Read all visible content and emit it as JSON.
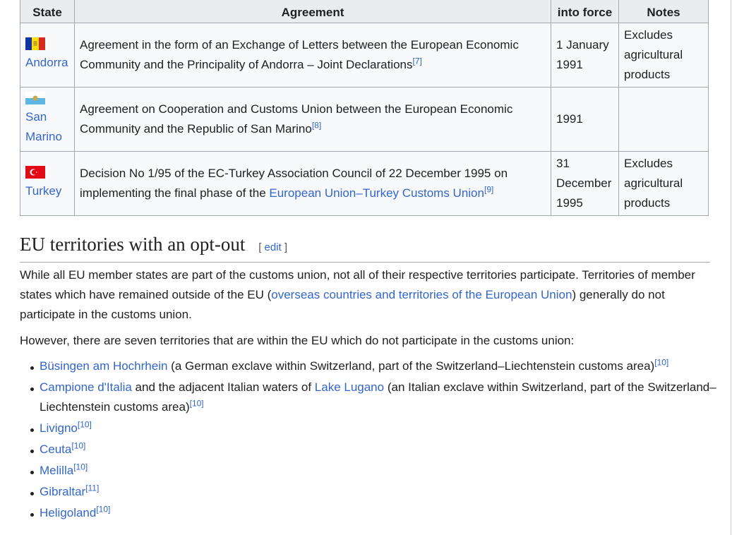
{
  "table": {
    "headers": {
      "state": "State",
      "agreement": "Agreement",
      "entry": "into force",
      "notes": "Notes"
    },
    "rows": [
      {
        "flag": "andorra-flag",
        "state": "Andorra",
        "agreement": "Agreement in the form of an Exchange of Letters between the European Economic Community and the Principality of Andorra – Joint Declarations",
        "agreement_ref": "[7]",
        "date": "1 January 1991",
        "notes": "Excludes agricultural products"
      },
      {
        "flag": "san-marino-flag",
        "state": "San Marino",
        "agreement": "Agreement on Cooperation and Customs Union between the European Economic Community and the Republic of San Marino",
        "agreement_ref": "[8]",
        "date": "1991",
        "notes": ""
      },
      {
        "flag": "turkey-flag",
        "state": "Turkey",
        "agreement_pre": "Decision No 1/95 of the EC-Turkey Association Council of 22 December 1995 on implementing the final phase of the ",
        "agreement_link": "European Union–Turkey Customs Union",
        "agreement_ref": "[9]",
        "date": "31 December 1995",
        "notes": "Excludes agricultural products"
      }
    ]
  },
  "section": {
    "title": "EU territories with an opt-out",
    "edit_open": "[ ",
    "edit_label": "edit",
    "edit_close": " ]"
  },
  "para1": {
    "pre": "While all EU member states are part of the customs union, not all of their respective territories participate. Territories of member states which have remained outside of the EU (",
    "link": "overseas countries and territories of the European Union",
    "post": ") generally do not participate in the customs union."
  },
  "para2": "However, there are seven territories that are within the EU which do not participate in the customs union:",
  "territories": [
    {
      "link": "Büsingen am Hochrhein",
      "text": " (a German exclave within Switzerland, part of the Switzerland–Liechtenstein customs area)",
      "ref": "[10]"
    },
    {
      "link": "Campione d'Italia",
      "text": " and the adjacent Italian waters of ",
      "link2": "Lake Lugano",
      "text2": " (an Italian exclave within Switzerland, part of the Switzerland–Liechtenstein customs area)",
      "ref": "[10]"
    },
    {
      "link": "Livigno",
      "ref": "[10]"
    },
    {
      "link": "Ceuta",
      "ref": "[10]"
    },
    {
      "link": "Melilla",
      "ref": "[10]"
    },
    {
      "link": "Gibraltar",
      "ref": "[11]"
    },
    {
      "link": "Heligoland",
      "ref": "[10]"
    }
  ],
  "colors": {
    "link": "#3366cc",
    "text": "#202122",
    "border": "#a2a9b1"
  }
}
